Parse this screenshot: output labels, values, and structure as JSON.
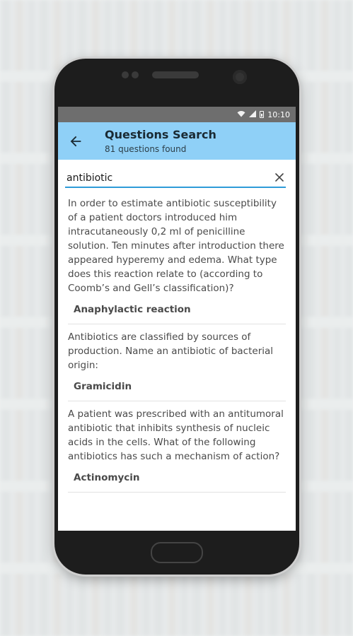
{
  "status_bar": {
    "time": "10:10"
  },
  "app_bar": {
    "title": "Questions Search",
    "subtitle": "81 questions found"
  },
  "search": {
    "value": "antibiotic"
  },
  "results": [
    {
      "question": "In order to estimate antibiotic susceptibility of a patient doctors introduced him intracutaneously 0,2 ml of penicilline solution. Ten minutes after introduction there appeared hyperemy and edema. What type does this reaction relate to (according to Coomb’s and Gell’s classification)?",
      "answer": "Anaphylactic reaction"
    },
    {
      "question": "Antibiotics are classified by sources of production. Name an antibiotic of bacterial origin:",
      "answer": "Gramicidin"
    },
    {
      "question": "A patient was prescribed with an antitumoral antibiotic that inhibits synthesis of nucleic acids in the cells. What of the following antibiotics has such a mechanism of action?",
      "answer": "Actinomycin"
    }
  ],
  "colors": {
    "app_bar": "#8fd0f7",
    "accent": "#2e9bd8",
    "status_bar": "#6e6e6e"
  },
  "icons": {
    "back": "arrow-left-icon",
    "clear": "close-icon",
    "wifi": "wifi-icon",
    "signal": "signal-icon",
    "battery": "battery-icon"
  }
}
